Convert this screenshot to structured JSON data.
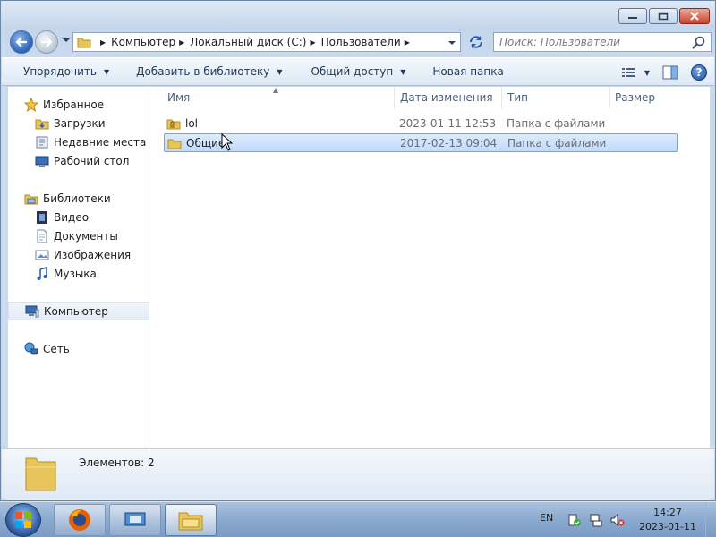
{
  "window": {
    "caption_buttons": [
      "minimize",
      "maximize",
      "close"
    ]
  },
  "address": {
    "crumbs": [
      "Компьютер",
      "Локальный диск (C:)",
      "Пользователи"
    ]
  },
  "search": {
    "placeholder": "Поиск: Пользователи"
  },
  "toolbar": {
    "organize": "Упорядочить",
    "add_to_library": "Добавить в библиотеку",
    "share": "Общий доступ",
    "new_folder": "Новая папка",
    "help": "?"
  },
  "sidebar": {
    "favorites": {
      "label": "Избранное",
      "items": [
        "Загрузки",
        "Недавние места",
        "Рабочий стол"
      ]
    },
    "libraries": {
      "label": "Библиотеки",
      "items": [
        "Видео",
        "Документы",
        "Изображения",
        "Музыка"
      ]
    },
    "computer": "Компьютер",
    "network": "Сеть"
  },
  "columns": {
    "name": "Имя",
    "date": "Дата изменения",
    "type": "Тип",
    "size": "Размер"
  },
  "files": [
    {
      "name": "lol",
      "date": "2023-01-11 12:53",
      "type": "Папка с файлами",
      "selected": false
    },
    {
      "name": "Общие",
      "date": "2017-02-13 09:04",
      "type": "Папка с файлами",
      "selected": true
    }
  ],
  "details": {
    "count": "Элементов: 2"
  },
  "taskbar": {
    "lang": "EN",
    "time": "14:27",
    "date": "2023-01-11"
  },
  "colors": {
    "accent": "#1e395b",
    "selection": "#c1dbfc",
    "window_frame": "#c9d9ee"
  }
}
